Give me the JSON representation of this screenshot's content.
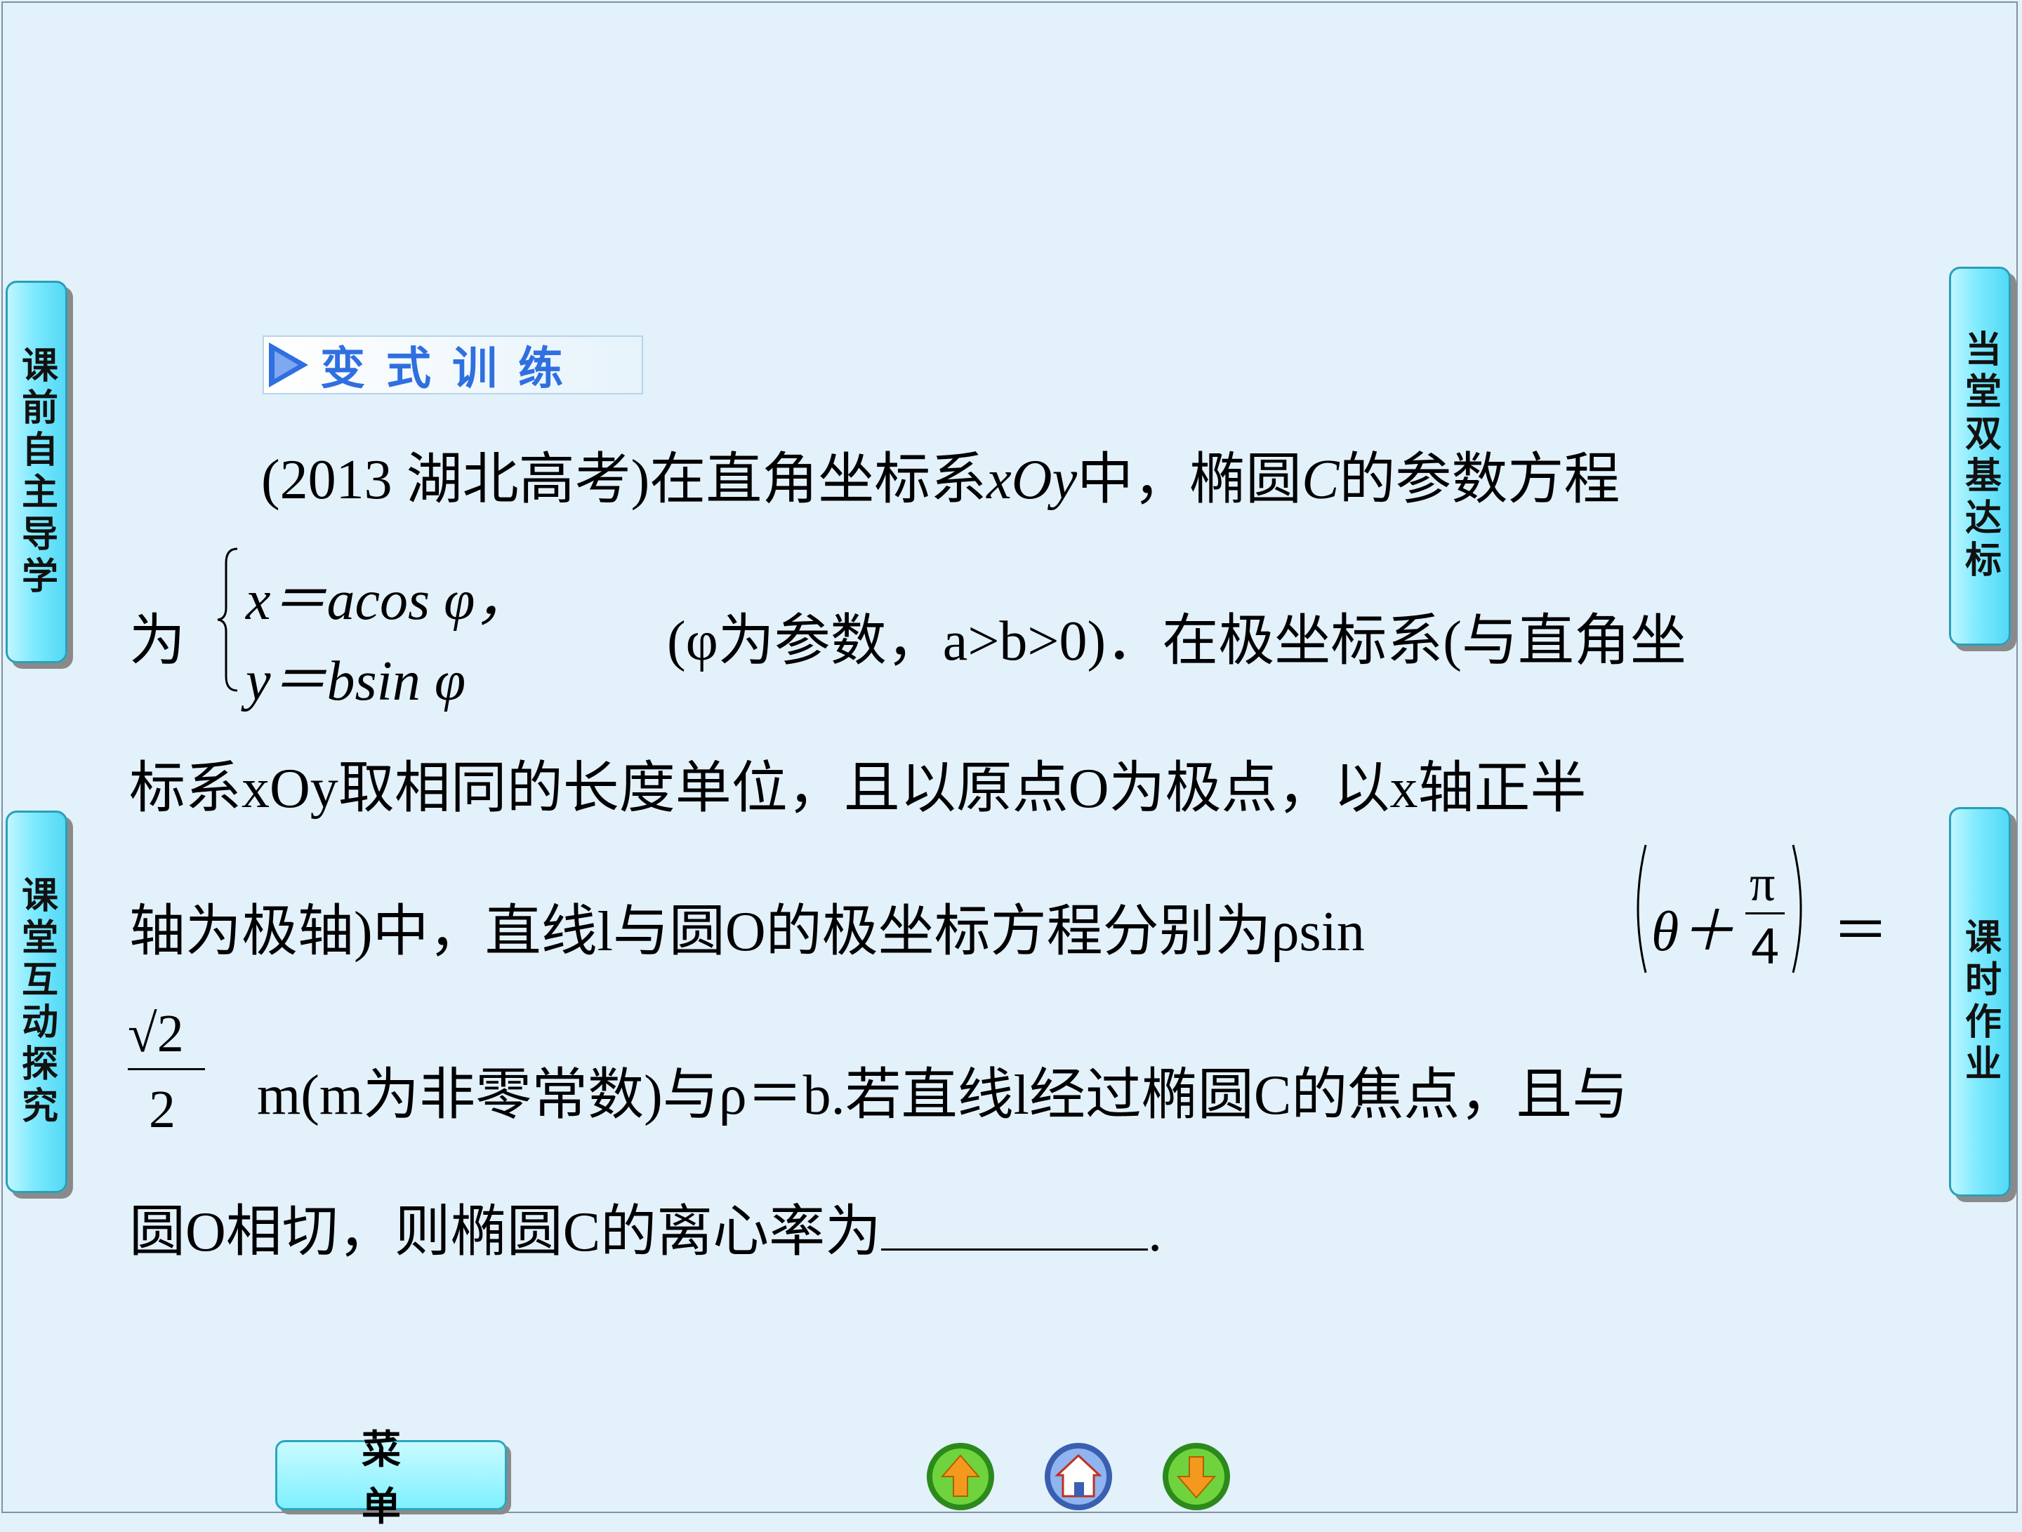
{
  "sidebar_left": {
    "top_label": "课前自主导学",
    "bottom_label": "课堂互动探究"
  },
  "sidebar_right": {
    "top_label": "当堂双基达标",
    "bottom_label": "课时作业"
  },
  "heading": "变式训练",
  "problem": {
    "l1_source": "(2013 湖北高考)",
    "l1_text": "在直角坐标系",
    "l1_var": "xOy",
    "l1_text2": "中，椭圆",
    "l1_C": "C",
    "l1_text3": "的参数方程",
    "l2_prefix": "为",
    "sys_row1": "x＝acos φ，",
    "sys_row2": "y＝bsin φ",
    "l2_suffix": "(φ为参数，a>b>0)．在极坐标系(与直角坐",
    "l3": "标系xOy取相同的长度单位，且以原点O为极点，以x轴正半",
    "l4a": "轴为极轴)中，直线l与圆O的极坐标方程分别为ρsin",
    "l4_theta": "θ＋",
    "l4_pi": "π",
    "l4_4": "4",
    "l4_eq": "＝",
    "l5_sqrt": "√2",
    "l5_den": "2",
    "l5_text": "m(m为非零常数)与ρ＝b.若直线l经过椭圆C的焦点，且与",
    "l6_text": "圆O相切，则椭圆C的离心率为",
    "l6_end": "."
  },
  "bottom": {
    "menu_label": "菜单"
  },
  "nav": {
    "prev_icon": "up-arrow-icon",
    "home_icon": "home-icon",
    "next_icon": "down-arrow-icon"
  }
}
